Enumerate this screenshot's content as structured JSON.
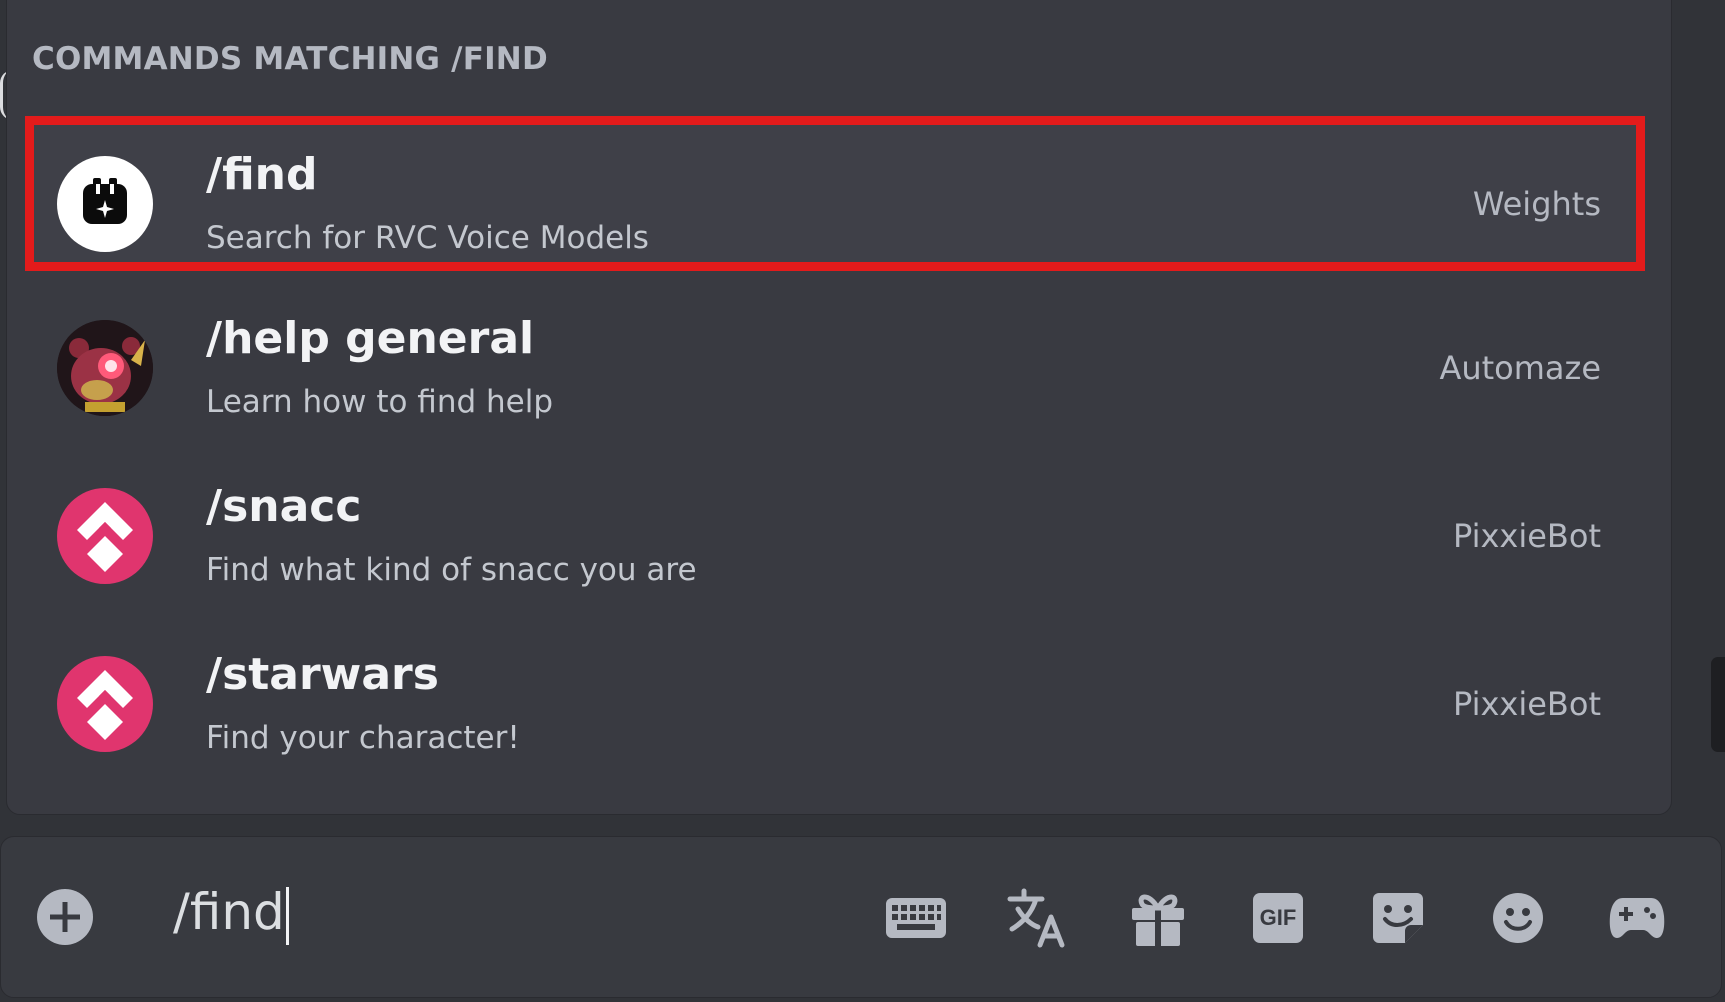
{
  "popup": {
    "header": "COMMANDS MATCHING /FIND",
    "commands": [
      {
        "name": "/find",
        "description": "Search for RVC Voice Models",
        "source": "Weights",
        "icon": "weights-bot-icon"
      },
      {
        "name": "/help general",
        "description": "Learn how to find help",
        "source": "Automaze",
        "icon": "automaze-bot-avatar"
      },
      {
        "name": "/snacc",
        "description": "Find what kind of snacc you are",
        "source": "PixxieBot",
        "icon": "pixxiebot-icon"
      },
      {
        "name": "/starwars",
        "description": "Find your character!",
        "source": "PixxieBot",
        "icon": "pixxiebot-icon"
      }
    ]
  },
  "input": {
    "value": "/find",
    "toolbar": {
      "gif_label": "GIF",
      "icons": [
        "add-icon",
        "keyboard-icon",
        "translate-icon",
        "gift-icon",
        "gif-icon",
        "sticker-icon",
        "emoji-icon",
        "activities-icon"
      ]
    }
  },
  "colors": {
    "selection_outline": "#e31b1b",
    "pixxiebot_pink": "#e0356e",
    "icon_gray": "#b5b9c2"
  }
}
